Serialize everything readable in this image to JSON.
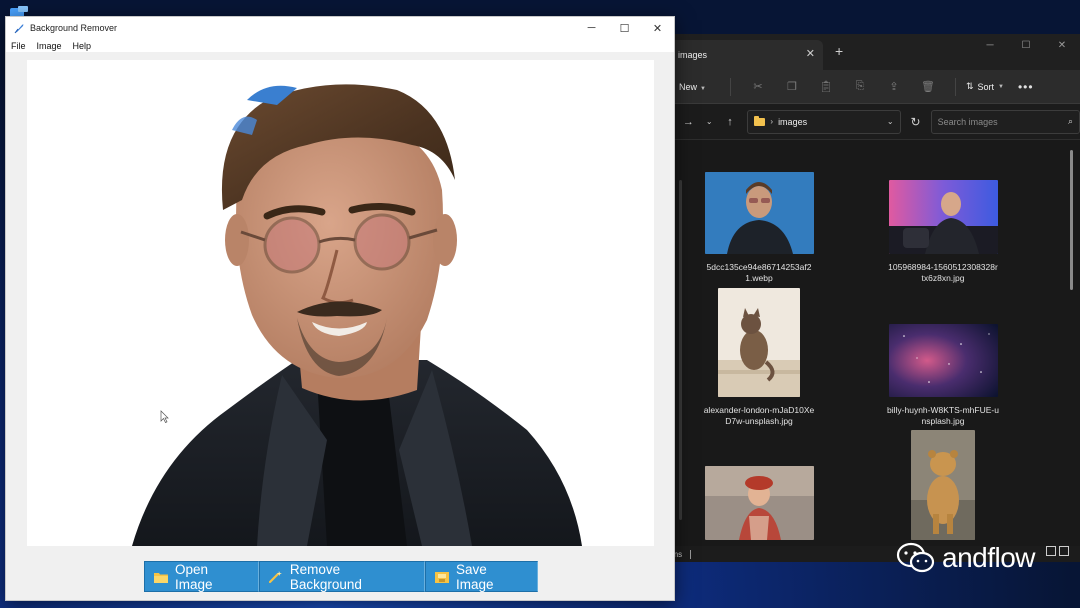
{
  "app": {
    "title": "Background Remover",
    "menu": [
      "File",
      "Image",
      "Help"
    ],
    "buttons": {
      "open": "Open Image",
      "remove": "Remove Background",
      "save": "Save Image"
    }
  },
  "explorer": {
    "tab_title": "images",
    "toolbar": {
      "new_label": "New",
      "sort_label": "Sort"
    },
    "address": "images",
    "search_placeholder": "Search images",
    "files": [
      {
        "name": "5dcc135ce94e86714253af21.webp"
      },
      {
        "name": "105968984-1560512308328rtx6z8xn.jpg"
      },
      {
        "name": "alexander-london-mJaD10XeD7w-unsplash.jpg"
      },
      {
        "name": "billy-huynh-W8KTS-mhFUE-unsplash.jpg"
      },
      {
        "name": ""
      },
      {
        "name": ""
      }
    ],
    "status": "ems"
  },
  "watermark": "andflow",
  "colors": {
    "button_blue": "#2f8fd0",
    "explorer_bg": "#1c1c1c",
    "folder_yellow": "#f2c14e"
  }
}
